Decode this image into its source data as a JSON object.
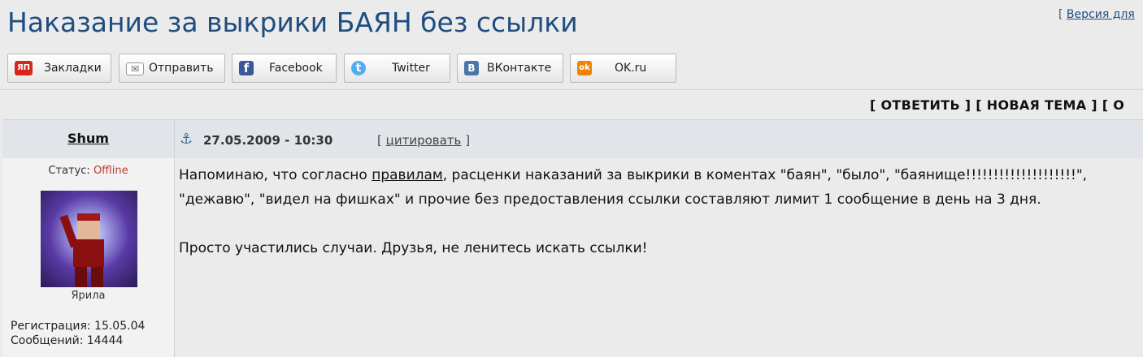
{
  "page": {
    "title": "Наказание за выкрики БАЯН без ссылки",
    "version_prefix": "[ ",
    "version_link": "Версия для"
  },
  "share": {
    "buttons": [
      {
        "label": "Закладки",
        "icon": "yap-icon",
        "icon_text": "ЯП",
        "color": "#d9261c"
      },
      {
        "label": "Отправить",
        "icon": "envelope-icon",
        "icon_text": "✉",
        "color": "#ffffff"
      },
      {
        "label": "Facebook",
        "icon": "facebook-icon",
        "icon_text": "f",
        "color": "#3b5998"
      },
      {
        "label": "Twitter",
        "icon": "twitter-icon",
        "icon_text": "t",
        "color": "#55acee"
      },
      {
        "label": "ВКонтакте",
        "icon": "vk-icon",
        "icon_text": "B",
        "color": "#4a76a8"
      },
      {
        "label": "OK.ru",
        "icon": "ok-icon",
        "icon_text": "ok",
        "color": "#ee8208"
      }
    ]
  },
  "actions": {
    "reply": "[ ОТВЕТИТЬ ]",
    "new_topic": "[ НОВАЯ ТЕМА ]",
    "more": "[ О"
  },
  "post": {
    "author": "Shum",
    "date": "27.05.2009 - 10:30",
    "quote_open": "[",
    "quote_label": "цитировать",
    "quote_close": "]",
    "status_label": "Статус:",
    "status_value": "Offline",
    "rank": "Ярила",
    "registration": "Регистрация: 15.05.04",
    "messages": "Сообщений: 14444",
    "body_p1_before": "Напоминаю, что согласно ",
    "body_p1_link": "правилам",
    "body_p1_after": ", расценки наказаний за выкрики в коментах \"баян\", \"было\", \"баянище!!!!!!!!!!!!!!!!!!!!\", \"дежавю\", \"видел на фишках\" и прочие без предоставления ссылки составляют лимит 1 сообщение в день на 3 дня.",
    "body_p2": "Просто участились случаи. Друзья, не ленитесь искать ссылки!"
  },
  "colors": {
    "title": "#1f4d80",
    "offline": "#c0392b",
    "header_bg": "#e1e4e8"
  }
}
